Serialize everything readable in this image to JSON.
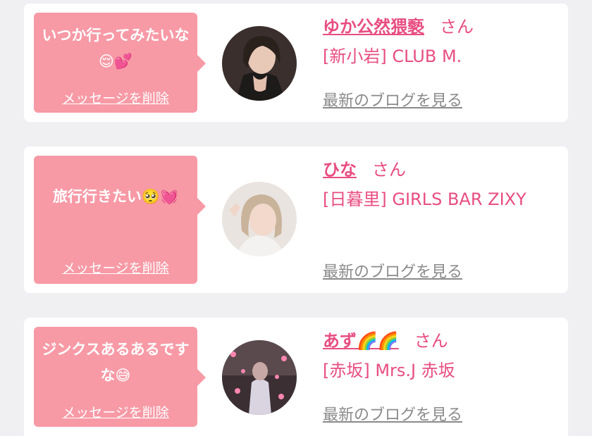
{
  "messages": [
    {
      "bubble_text": "いつか行ってみたいな😌💕",
      "delete_label": "メッセージを削除",
      "name": "ゆか公然猥褻",
      "honorific": "さん",
      "shop": "[新小岩] CLUB M.",
      "blog_label": "最新のブログを見る",
      "avatar_icon": "woman-dark-hair-avatar-icon"
    },
    {
      "bubble_text": "旅行行きたい🥺💓",
      "delete_label": "メッセージを削除",
      "name": "ひな",
      "honorific": "さん",
      "shop": "[日暮里] GIRLS BAR ZIXY",
      "blog_label": "最新のブログを見る",
      "avatar_icon": "woman-blonde-hair-avatar-icon"
    },
    {
      "bubble_text": "ジンクスあるあるですな😅",
      "delete_label": "メッセージを削除",
      "name": "あず🌈🌈",
      "honorific": "さん",
      "shop": "[赤坂] Mrs.J 赤坂",
      "blog_label": "最新のブログを見る",
      "avatar_icon": "woman-heart-filter-avatar-icon"
    }
  ],
  "colors": {
    "bubble": "#f79aa6",
    "accent": "#e84d82",
    "link_gray": "#8a8a8a",
    "background": "#f0eff1"
  }
}
